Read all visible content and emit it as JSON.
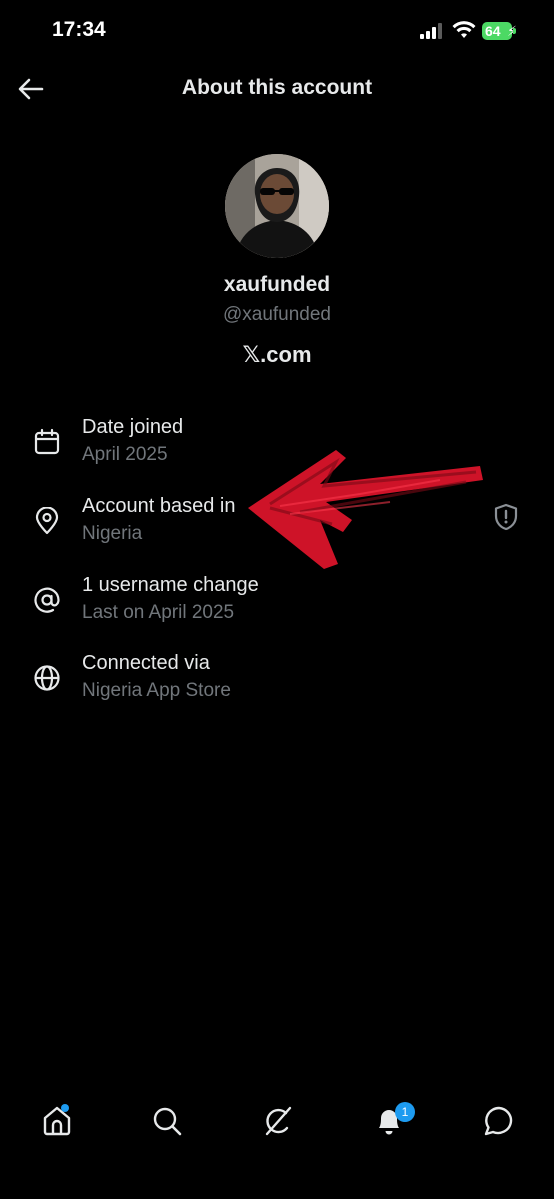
{
  "status_bar": {
    "time": "17:34",
    "battery": "64"
  },
  "header": {
    "title": "About this account"
  },
  "profile": {
    "display_name": "xaufunded",
    "handle": "@xaufunded",
    "site": "𝕏.com"
  },
  "rows": [
    {
      "title": "Date joined",
      "value": "April 2025",
      "icon": "calendar-icon"
    },
    {
      "title": "Account based in",
      "value": "Nigeria",
      "icon": "location-pin-icon",
      "trailing_icon": "shield-alert-icon"
    },
    {
      "title": "1 username change",
      "value": "Last on April 2025",
      "icon": "at-sign-icon"
    },
    {
      "title": "Connected via",
      "value": "Nigeria App Store",
      "icon": "globe-icon"
    }
  ],
  "bottom_nav": {
    "items": [
      "home-icon",
      "search-icon",
      "grok-icon",
      "notifications-icon",
      "messages-icon"
    ],
    "notification_count": "1"
  },
  "colors": {
    "background": "#000000",
    "primary_text": "#e7e9ea",
    "secondary_text": "#71767b",
    "accent": "#1d9bf0",
    "annotation_arrow": "#d9142a",
    "battery": "#4cd964"
  }
}
